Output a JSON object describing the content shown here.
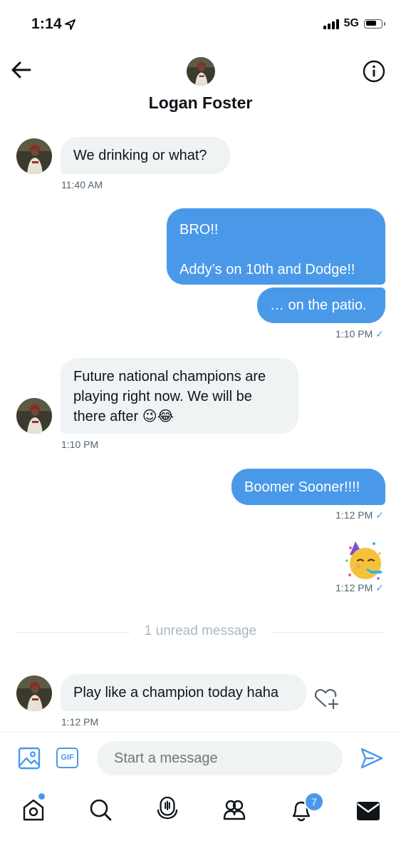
{
  "status_bar": {
    "time": "1:14",
    "network": "5G"
  },
  "header": {
    "name": "Logan Foster"
  },
  "messages": [
    {
      "direction": "in",
      "text": "We drinking or what?",
      "time": "11:40 AM"
    },
    {
      "direction": "out",
      "lines": [
        "BRO!!",
        "",
        "Addy’s on 10th and Dodge!!"
      ]
    },
    {
      "direction": "out",
      "text": "… on the patio.",
      "time": "1:10 PM"
    },
    {
      "direction": "in",
      "lines": [
        "Future national champions are",
        "playing right now. We will be",
        "there after 😉😂"
      ],
      "time": "1:10 PM"
    },
    {
      "direction": "out",
      "text": "Boomer Sooner!!!!",
      "time": "1:12 PM"
    },
    {
      "direction": "out",
      "emoji": "🥳",
      "time": "1:12 PM"
    },
    {
      "direction": "in",
      "text": "Play like a champion today haha",
      "time": "1:12 PM"
    }
  ],
  "divider": {
    "text": "1 unread message"
  },
  "composer": {
    "placeholder": "Start a message",
    "gif_label": "GIF"
  },
  "tabbar": {
    "notifications_count": "7"
  },
  "colors": {
    "accent": "#4a99e9",
    "incoming_bubble": "#eff3f4",
    "text": "#0f1419",
    "muted": "#536471"
  }
}
